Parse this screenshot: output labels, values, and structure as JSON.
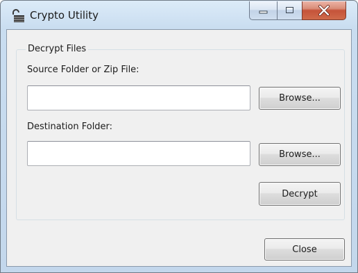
{
  "window": {
    "title": "Crypto Utility",
    "icon": "key-lock-icon",
    "caption_buttons": [
      "minimize-icon",
      "maximize-icon",
      "close-icon"
    ]
  },
  "group": {
    "legend": "Decrypt Files"
  },
  "source": {
    "label": "Source Folder or Zip File:",
    "value": "",
    "browse_label": "Browse..."
  },
  "destination": {
    "label": "Destination Folder:",
    "value": "",
    "browse_label": "Browse..."
  },
  "actions": {
    "decrypt_label": "Decrypt",
    "close_label": "Close"
  },
  "colors": {
    "close_button": "#c5533a",
    "titlebar": "#c9ddf0"
  }
}
